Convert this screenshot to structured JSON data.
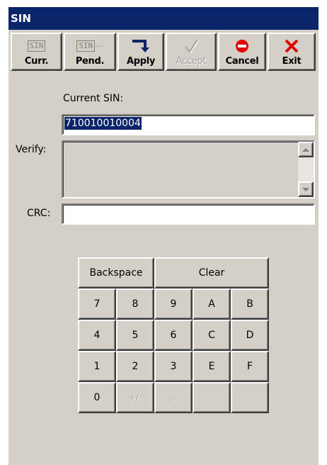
{
  "window": {
    "title": "SIN"
  },
  "toolbar": {
    "curr": {
      "label": "Curr.",
      "icon_text": "SIN"
    },
    "pend": {
      "label": "Pend.",
      "icon_text": "SIN"
    },
    "apply": {
      "label": "Apply"
    },
    "accept": {
      "label": "Accept"
    },
    "cancel": {
      "label": "Cancel"
    },
    "exit": {
      "label": "Exit"
    }
  },
  "form": {
    "current_sin_label": "Current SIN:",
    "current_sin_value": "710010010004",
    "verify_label": "Verify:",
    "verify_value": "",
    "crc_label": "CRC:",
    "crc_value": ""
  },
  "keypad": {
    "backspace": "Backspace",
    "clear": "Clear",
    "row1": [
      "7",
      "8",
      "9",
      "A",
      "B"
    ],
    "row2": [
      "4",
      "5",
      "6",
      "C",
      "D"
    ],
    "row3": [
      "1",
      "2",
      "3",
      "E",
      "F"
    ],
    "row4": [
      "0",
      "+/-",
      ".",
      "",
      ""
    ]
  },
  "colors": {
    "titlebar": "#0a246a",
    "face": "#d4d0c8",
    "apply_icon": "#0a246a",
    "cancel_icon": "#e00000",
    "exit_icon": "#e00000"
  }
}
